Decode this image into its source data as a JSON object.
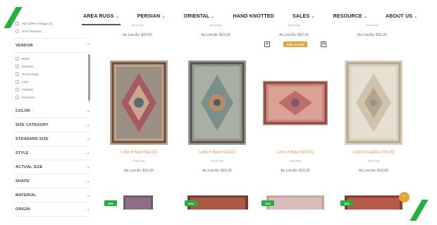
{
  "nav": {
    "items": [
      {
        "label": "AREA RUGS",
        "active": true
      },
      {
        "label": "PERSIAN",
        "active": false
      },
      {
        "label": "ORIENTAL",
        "active": false
      },
      {
        "label": "HAND KNOTTED",
        "active": false
      },
      {
        "label": "SALES",
        "active": false
      },
      {
        "label": "RESOURCE",
        "active": false
      },
      {
        "label": "ABOUT US",
        "active": false
      }
    ]
  },
  "sidebar": {
    "top_items": [
      "Hip-Cheer Vintage (2)",
      "Sour Runners"
    ],
    "vendor": {
      "label": "VENDOR",
      "items": [
        "Baker",
        "Dynamic",
        "Home Rugs",
        "Loloi",
        "Oriental",
        "Nourison"
      ]
    },
    "filters": [
      "COLOR",
      "SIZE CATEGORY",
      "STANDARD SIZE",
      "STYLE",
      "ACTUAL SIZE",
      "SHAPE",
      "MATERIAL",
      "ORIGIN"
    ]
  },
  "top_row": {
    "tiny": [
      "Area Rug",
      "Area Rug",
      "Area Rug",
      "Area Rug"
    ],
    "prices": [
      "As Low As: $19.60",
      "As Low As: $16.20",
      "As Low As: $16.20",
      "As Low As: $16.20"
    ],
    "add_to_cart": "Add To Cart",
    "heart_icon": "heart-icon",
    "compare_icon": "compare-icon"
  },
  "products": [
    {
      "title": "Loloi II Nour NO-03",
      "type": "Area Rug",
      "price": "As Low As: $16.20"
    },
    {
      "title": "Loloi II Nour NO-02",
      "type": "Area Rug",
      "price": "As Low As: $16.20"
    },
    {
      "title": "Loloi II Nour NO-01",
      "type": "Area Rug",
      "price": "As Low As: $16.20"
    },
    {
      "title": "Loloi II Isadora ISA-03",
      "type": "Area Rug",
      "price": "As Low As: $18.00"
    }
  ],
  "bottom_badges": [
    "10%",
    "10%",
    "10%",
    "10%"
  ],
  "scroll_top_icon": "arrow-up-icon"
}
